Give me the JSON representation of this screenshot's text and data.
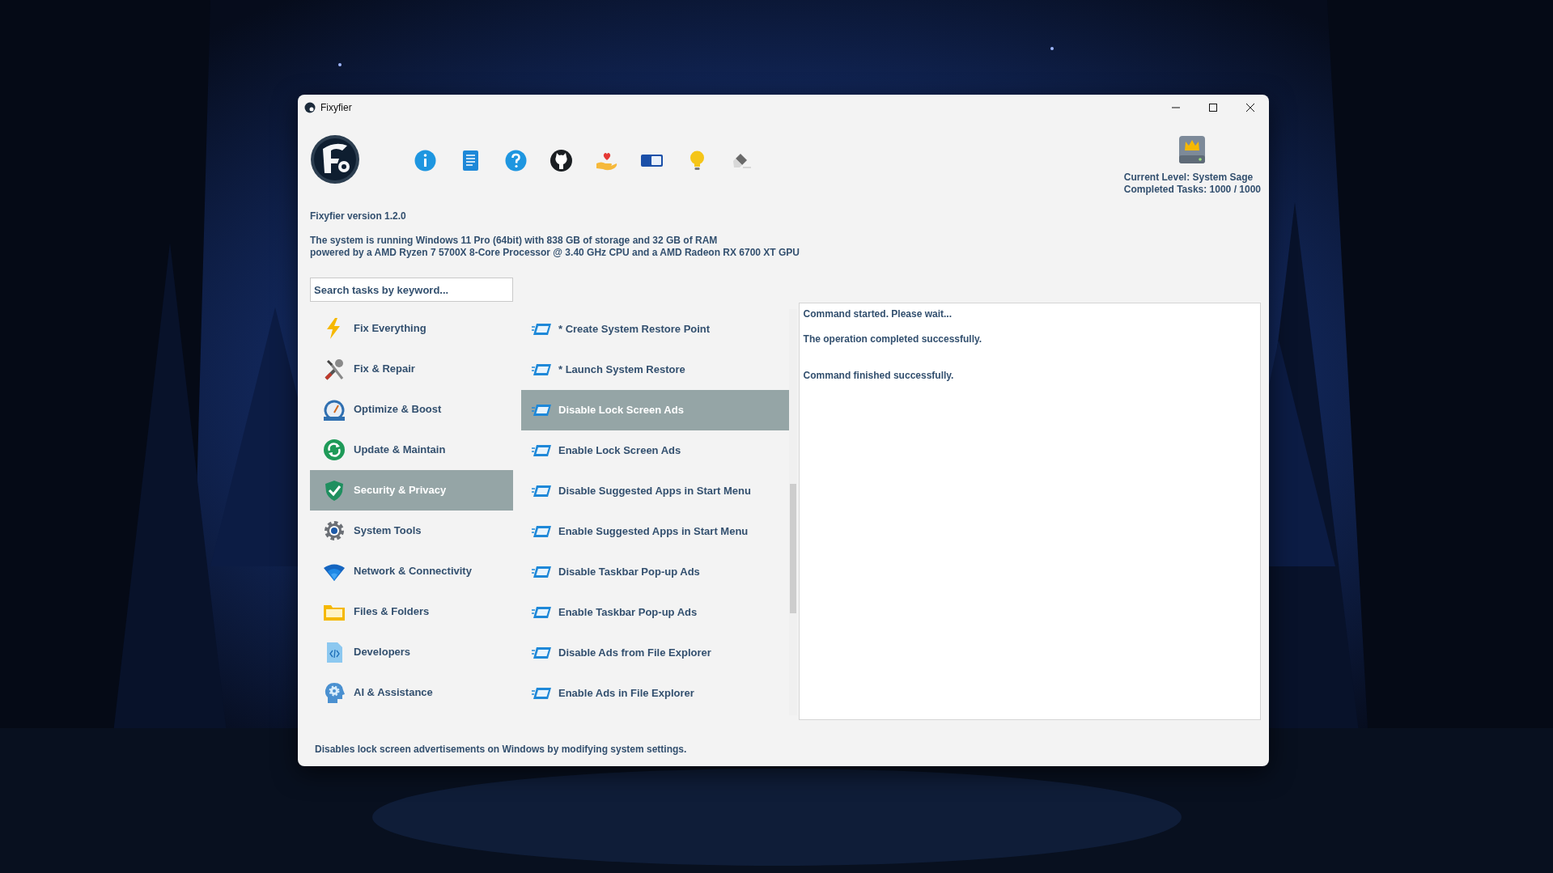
{
  "window": {
    "title": "Fixyfier"
  },
  "version": "Fixyfier version 1.2.0",
  "system_info": [
    "The system is running Windows 11 Pro (64bit) with 838 GB of storage and 32 GB of RAM",
    "powered by a AMD Ryzen 7 5700X 8-Core Processor @ 3.40 GHz CPU and a AMD Radeon RX 6700 XT GPU"
  ],
  "level": {
    "current": "Current Level: System Sage",
    "completed": "Completed Tasks: 1000 / 1000"
  },
  "search": {
    "placeholder": "Search tasks by keyword..."
  },
  "categories": [
    {
      "label": "Fix Everything",
      "selected": false
    },
    {
      "label": "Fix & Repair",
      "selected": false
    },
    {
      "label": "Optimize & Boost",
      "selected": false
    },
    {
      "label": "Update & Maintain",
      "selected": false
    },
    {
      "label": "Security & Privacy",
      "selected": true
    },
    {
      "label": "System Tools",
      "selected": false
    },
    {
      "label": "Network & Connectivity",
      "selected": false
    },
    {
      "label": "Files & Folders",
      "selected": false
    },
    {
      "label": "Developers",
      "selected": false
    },
    {
      "label": "AI & Assistance",
      "selected": false
    }
  ],
  "tasks": [
    {
      "label": "* Create System Restore Point",
      "selected": false
    },
    {
      "label": "* Launch System Restore",
      "selected": false
    },
    {
      "label": "Disable Lock Screen Ads",
      "selected": true
    },
    {
      "label": "Enable Lock Screen Ads",
      "selected": false
    },
    {
      "label": "Disable Suggested Apps in Start Menu",
      "selected": false
    },
    {
      "label": "Enable Suggested Apps in Start Menu",
      "selected": false
    },
    {
      "label": "Disable Taskbar Pop-up Ads",
      "selected": false
    },
    {
      "label": "Enable Taskbar Pop-up Ads",
      "selected": false
    },
    {
      "label": "Disable Ads from File Explorer",
      "selected": false
    },
    {
      "label": "Enable Ads in File Explorer",
      "selected": false
    }
  ],
  "output": [
    "Command started. Please wait...",
    "The operation completed successfully.",
    "Command finished successfully."
  ],
  "status_text": "Disables lock screen advertisements on Windows by modifying system settings."
}
